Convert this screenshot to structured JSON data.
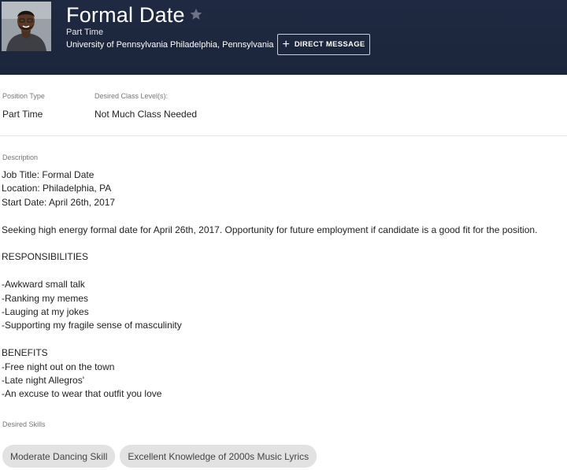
{
  "header": {
    "title": "Formal Date",
    "type": "Part Time",
    "employer": "University of Pennsylvania Philadelphia, Pennsylvania",
    "dm_button_label": "DIRECT MESSAGE"
  },
  "details": {
    "position_type_label": "Position Type",
    "position_type_value": "Part Time",
    "class_level_label": "Desired Class Level(s):",
    "class_level_value": "Not Much Class Needed"
  },
  "description": {
    "label": "Description",
    "lines": [
      "Job Title: Formal Date",
      "Location: Philadelphia, PA",
      "Start Date: April 26th, 2017",
      "",
      "Seeking high energy formal date for April 26th, 2017. Opportunity for future employment if candidate is a good fit for the position.",
      "",
      "RESPONSIBILITIES",
      "",
      "-Awkward small talk",
      "-Ranking my memes",
      "-Lauging at my jokes",
      "-Supporting my fragile sense of masculinity",
      "",
      "BENEFITS",
      "-Free night out on the town",
      "-Late night Allegros'",
      "-An excuse to wear that outfit you love"
    ]
  },
  "skills": {
    "label": "Desired Skills",
    "items": [
      "Moderate Dancing Skill",
      "Excellent Knowledge of 2000s Music Lyrics"
    ]
  },
  "colors": {
    "header_bg": "#1f2a42",
    "chip_bg": "#e2e2e2"
  }
}
